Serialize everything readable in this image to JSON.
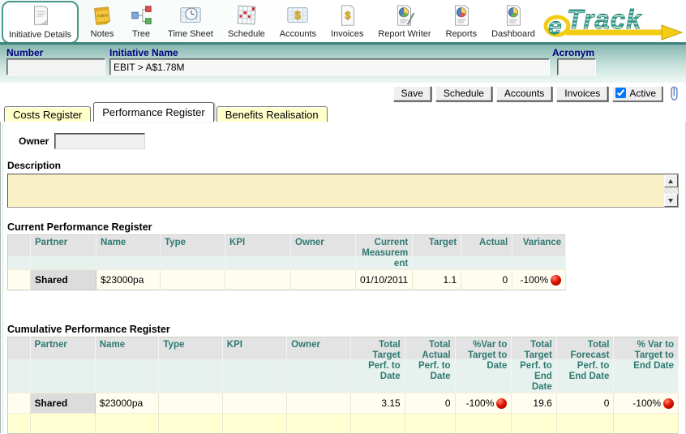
{
  "toolbar": {
    "items": [
      {
        "label": "Initiative Details",
        "icon": "initiative-details-icon",
        "selected": true
      },
      {
        "label": "Notes",
        "icon": "notes-icon",
        "selected": false
      },
      {
        "label": "Tree",
        "icon": "tree-icon",
        "selected": false
      },
      {
        "label": "Time Sheet",
        "icon": "time-sheet-icon",
        "selected": false
      },
      {
        "label": "Schedule",
        "icon": "schedule-icon",
        "selected": false
      },
      {
        "label": "Accounts",
        "icon": "accounts-icon",
        "selected": false
      },
      {
        "label": "Invoices",
        "icon": "invoices-icon",
        "selected": false
      },
      {
        "label": "Report Writer",
        "icon": "report-writer-icon",
        "selected": false
      },
      {
        "label": "Reports",
        "icon": "reports-icon",
        "selected": false
      },
      {
        "label": "Dashboard",
        "icon": "dashboard-icon",
        "selected": false
      }
    ],
    "logo_text": "eTrack"
  },
  "header_fields": {
    "number": {
      "label": "Number",
      "value": ""
    },
    "initiative_name": {
      "label": "Initiative Name",
      "value": "EBIT > A$1.78M"
    },
    "acronym": {
      "label": "Acronym",
      "value": ""
    }
  },
  "action_bar": {
    "save_label": "Save",
    "schedule_label": "Schedule",
    "accounts_label": "Accounts",
    "invoices_label": "Invoices",
    "active_label": "Active",
    "active_checked": true,
    "attachment_icon": "paperclip-icon"
  },
  "tabs": [
    {
      "label": "Costs Register",
      "active": false
    },
    {
      "label": "Performance Register",
      "active": true
    },
    {
      "label": "Benefits Realisation",
      "active": false
    }
  ],
  "form": {
    "owner_label": "Owner",
    "owner_value": "",
    "description_label": "Description",
    "description_value": ""
  },
  "current_register": {
    "title": "Current Performance Register",
    "columns": [
      "",
      "Partner",
      "Name",
      "Type",
      "KPI",
      "Owner",
      "Current Measurement",
      "Target",
      "Actual",
      "Variance"
    ],
    "rows": [
      {
        "partner": "Shared",
        "name": "$23000pa",
        "type": "",
        "kpi": "",
        "owner": "",
        "current_measurement": "01/10/2011",
        "target": "1.1",
        "actual": "0",
        "variance": "-100%",
        "variance_indicator": "red-ball"
      }
    ]
  },
  "cumulative_register": {
    "title": "Cumulative Performance Register",
    "columns": [
      "",
      "Partner",
      "Name",
      "Type",
      "KPI",
      "Owner",
      "Total Target Perf. to Date",
      "Total Actual Perf. to Date",
      "%Var to Target to Date",
      "Total Target Perf. to End Date",
      "Total Forecast Perf. to End Date",
      "% Var to Target to End Date"
    ],
    "rows": [
      {
        "partner": "Shared",
        "name": "$23000pa",
        "type": "",
        "kpi": "",
        "owner": "",
        "total_target_perf_to_date": "3.15",
        "total_actual_perf_to_date": "0",
        "pvar_to_target_to_date": "-100%",
        "pvar_to_target_to_date_indicator": "red-ball",
        "total_target_perf_to_end_date": "19.6",
        "total_forecast_perf_to_end_date": "0",
        "pvar_to_target_to_end_date": "-100%",
        "pvar_to_target_to_end_date_indicator": "red-ball"
      }
    ],
    "trailing_empty_row": true
  },
  "colors": {
    "brand_teal": "#35a08e",
    "brand_arrow_yellow": "#f2cd13",
    "band_teal_top": "#85b7af",
    "field_label_navy": "#00007e",
    "table_header_text_teal": "#2e7a72",
    "row_cream": "#fffdf0",
    "empty_row_yellow": "#ffffd2",
    "description_cream": "#faf0c5",
    "inactive_tab_yellow": "#ffffc9",
    "status_red": "#e21200"
  }
}
